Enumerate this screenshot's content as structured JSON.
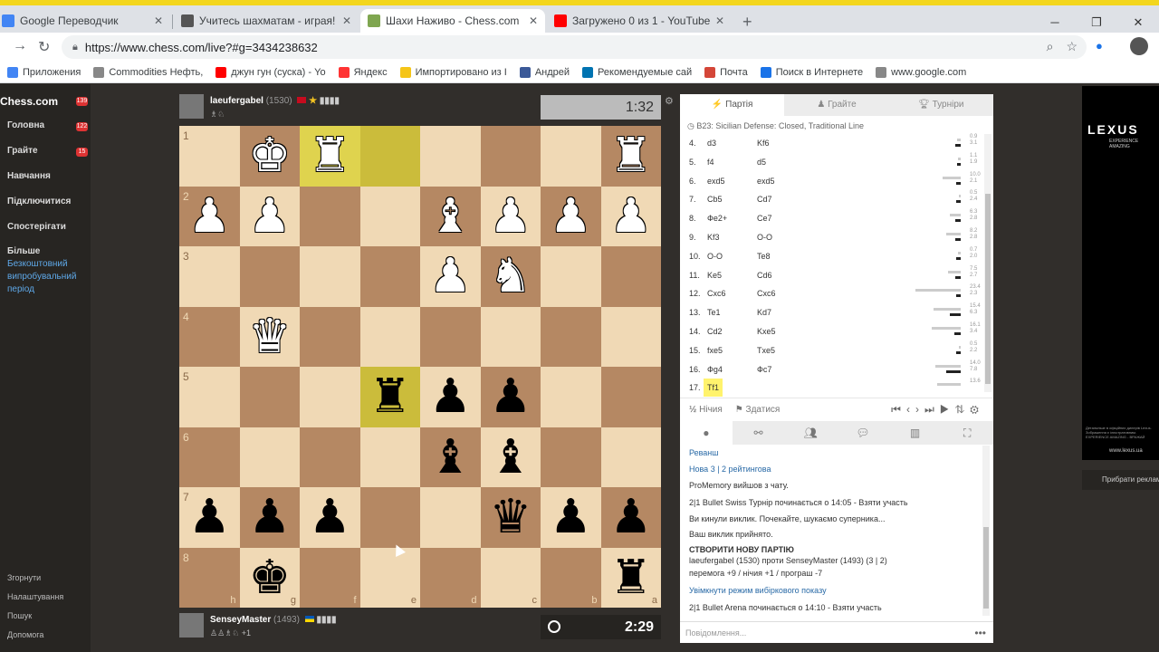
{
  "browser": {
    "tabs": [
      {
        "title": "Google Переводчик",
        "color": "#4285f4"
      },
      {
        "title": "Учитесь шахматам - играя! • lich",
        "color": "#555555"
      },
      {
        "title": "Шахи Наживо - Chess.com",
        "color": "#7fa650"
      },
      {
        "title": "Загружено 0 из 1 - YouTube",
        "color": "#ff0000"
      }
    ],
    "active_tab_index": 2,
    "url": "https://www.chess.com/live?#g=3434238632",
    "bookmarks": [
      {
        "label": "Приложения",
        "color": "#4285f4"
      },
      {
        "label": "Commodities Нефть,",
        "color": "#888888"
      },
      {
        "label": "джун гун (суска) - Yo",
        "color": "#ff0000"
      },
      {
        "label": "Яндекс",
        "color": "#ff3333"
      },
      {
        "label": "Импортировано из I",
        "color": "#f5c518"
      },
      {
        "label": "Андрей",
        "color": "#3b5998"
      },
      {
        "label": "Рекомендуемые сай",
        "color": "#0073b1"
      },
      {
        "label": "Почта",
        "color": "#d44638"
      },
      {
        "label": "Поиск в Интернете",
        "color": "#1a73e8"
      },
      {
        "label": "www.google.com",
        "color": "#888888"
      }
    ]
  },
  "nav": {
    "logo": "Chess.com",
    "logo_badge": "139",
    "items": [
      {
        "label": "Головна",
        "badge": "122"
      },
      {
        "label": "Грайте",
        "badge": "15"
      },
      {
        "label": "Навчання",
        "badge": ""
      },
      {
        "label": "Підключитися",
        "badge": ""
      },
      {
        "label": "Спостерігати",
        "badge": ""
      },
      {
        "label": "Більше",
        "badge": ""
      }
    ],
    "promo": "Безкоштовний випробувальний період",
    "bottom": [
      "Згорнути",
      "Налаштування",
      "Пошук",
      "Допомога"
    ]
  },
  "player_top": {
    "name": "laeufergabel",
    "rating": "(1530)",
    "clock": "1:32",
    "info": "♗♘"
  },
  "player_bottom": {
    "name": "SenseyMaster",
    "rating": "(1493)",
    "clock": "2:29",
    "info": "♙♙♗♘ +1"
  },
  "board": {
    "ranks": [
      "1",
      "2",
      "3",
      "4",
      "5",
      "6",
      "7",
      "8"
    ],
    "files": [
      "h",
      "g",
      "f",
      "e",
      "d",
      "c",
      "b",
      "a"
    ],
    "squares": [
      [
        "",
        "wk",
        "wr",
        "",
        "",
        "",
        "",
        "wr"
      ],
      [
        "wp",
        "wp",
        "",
        "",
        "wb",
        "wp",
        "wp",
        "wp"
      ],
      [
        "",
        "",
        "",
        "",
        "wp",
        "wn",
        "",
        ""
      ],
      [
        "",
        "wq",
        "",
        "",
        "",
        "",
        "",
        ""
      ],
      [
        "",
        "",
        "",
        "br",
        "bp",
        "bp",
        "",
        ""
      ],
      [
        "",
        "",
        "",
        "",
        "bb",
        "bb",
        "",
        ""
      ],
      [
        "bp",
        "bp",
        "bp",
        "",
        "",
        "bq",
        "bp",
        "bp"
      ],
      [
        "",
        "bk",
        "",
        "",
        "",
        "",
        "",
        "br"
      ]
    ],
    "highlights": [
      "0-2",
      "0-3",
      "4-3"
    ]
  },
  "panel": {
    "tabs": [
      "Партія",
      "Грайте",
      "Турніри"
    ],
    "opening": "B23: Sicilian Defense: Closed, Traditional Line",
    "moves": [
      {
        "n": "4.",
        "w": "d3",
        "b": "Kf6",
        "e1": "0.9",
        "e2": "3.1",
        "w1": 4,
        "w2": 6
      },
      {
        "n": "5.",
        "w": "f4",
        "b": "d5",
        "e1": "1.1",
        "e2": "1.9",
        "w1": 3,
        "w2": 4
      },
      {
        "n": "6.",
        "w": "exd5",
        "b": "exd5",
        "e1": "10.0",
        "e2": "2.1",
        "w1": 20,
        "w2": 5
      },
      {
        "n": "7.",
        "w": "Cb5",
        "b": "Cd7",
        "e1": "0.5",
        "e2": "2.4",
        "w1": 2,
        "w2": 5
      },
      {
        "n": "8.",
        "w": "Фe2+",
        "b": "Ce7",
        "e1": "6.3",
        "e2": "2.8",
        "w1": 12,
        "w2": 6
      },
      {
        "n": "9.",
        "w": "Kf3",
        "b": "O-O",
        "e1": "8.2",
        "e2": "2.8",
        "w1": 16,
        "w2": 6
      },
      {
        "n": "10.",
        "w": "O-O",
        "b": "Te8",
        "e1": "0.7",
        "e2": "2.0",
        "w1": 3,
        "w2": 5
      },
      {
        "n": "11.",
        "w": "Ke5",
        "b": "Cd6",
        "e1": "7.5",
        "e2": "2.7",
        "w1": 14,
        "w2": 6
      },
      {
        "n": "12.",
        "w": "Cxc6",
        "b": "Cxc6",
        "e1": "23.4",
        "e2": "2.3",
        "w1": 50,
        "w2": 5
      },
      {
        "n": "13.",
        "w": "Te1",
        "b": "Kd7",
        "e1": "15.4",
        "e2": "6.3",
        "w1": 30,
        "w2": 12
      },
      {
        "n": "14.",
        "w": "Cd2",
        "b": "Kxe5",
        "e1": "16.1",
        "e2": "3.4",
        "w1": 32,
        "w2": 7
      },
      {
        "n": "15.",
        "w": "fxe5",
        "b": "Txe5",
        "e1": "0.5",
        "e2": "2.2",
        "w1": 2,
        "w2": 5
      },
      {
        "n": "16.",
        "w": "Фg4",
        "b": "Фc7",
        "e1": "14.0",
        "e2": "7.8",
        "w1": 28,
        "w2": 16
      },
      {
        "n": "17.",
        "w": "Tf1",
        "b": "",
        "e1": "13.6",
        "e2": "",
        "w1": 26,
        "w2": 0
      }
    ],
    "draw_label": "Нічия",
    "resign_label": "Здатися",
    "draw_icon": "½",
    "chat": [
      {
        "t": "Реванш",
        "k": "link"
      },
      {
        "t": "Нова 3 | 2 рейтингова",
        "k": "link"
      },
      {
        "t": "ProMemory вийшов з чату.",
        "k": "text"
      },
      {
        "t": "2|1 Bullet Swiss Турнір починається о 14:05 - Взяти участь",
        "k": "text"
      },
      {
        "t": "Ви кинули виклик. Почекайте, шукаємо суперника...",
        "k": "text"
      },
      {
        "t": "Ваш виклик прийнято.",
        "k": "text"
      },
      {
        "t": "СТВОРИТИ НОВУ ПАРТІЮ",
        "k": "bold"
      },
      {
        "t": "laeufergabel (1530) проти SenseyMaster (1493) (3 | 2)",
        "k": "text"
      },
      {
        "t": "перемога +9 / нічия +1 / програш -7",
        "k": "text"
      },
      {
        "t": "Увімкнути режим вибіркового показу",
        "k": "link"
      },
      {
        "t": "2|1 Bullet Arena починається о 14:10 - Взяти участь",
        "k": "text"
      }
    ],
    "chat_placeholder": "Повідомлення..."
  },
  "ad": {
    "brand": "LEXUS",
    "tagline": "EXPERIENCE AMAZING",
    "fine": "Детальніше в офіційних дилерів Lexus. Зображення є ілюстративним. EXPERIENCE AMAZING - ВРАЖАЙ",
    "url": "www.lexus.ua",
    "hide": "Прибрати реклами"
  }
}
